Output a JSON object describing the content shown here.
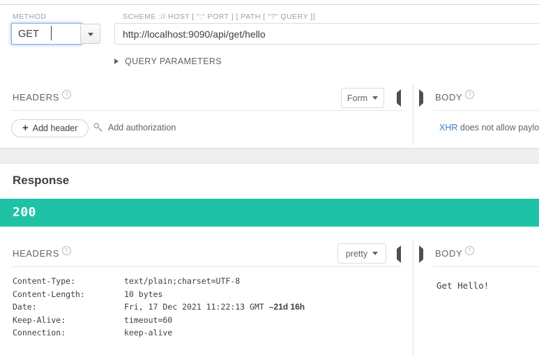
{
  "request": {
    "method_label": "METHOD",
    "method_value": "GET",
    "method_dropdown_icon": "chevron-down-icon",
    "url_label": "SCHEME :// HOST [ \":\" PORT ] [ PATH [ \"?\" QUERY ]]",
    "url_value": "http://localhost:9090/api/get/hello",
    "url_placeholder": "http://",
    "query_parameters_label": "QUERY PARAMETERS",
    "query_parameters_toggle_icon": "triangle-right-icon",
    "headers": {
      "title": "HEADERS",
      "help_icon": "question-circle-icon",
      "view_mode": "Form",
      "collapse_left_icon": "triangle-left-icon",
      "add_header_label": "Add header",
      "add_header_icon": "plus-icon",
      "add_authorization_label": "Add authorization",
      "add_authorization_icon": "key-icon"
    },
    "body": {
      "title": "BODY",
      "help_icon": "question-circle-icon",
      "expand_right_icon": "triangle-right-icon",
      "note_link": "XHR",
      "note_rest": " does not allow payloa"
    }
  },
  "response": {
    "title": "Response",
    "status_code": "200",
    "status_color": "#1ec2a4",
    "headers": {
      "title": "HEADERS",
      "help_icon": "question-circle-icon",
      "view_mode": "pretty",
      "collapse_left_icon": "triangle-left-icon",
      "rows": [
        {
          "key": "Content-Type:",
          "value": "text/plain;charset=UTF-8",
          "age": ""
        },
        {
          "key": "Content-Length:",
          "value": "10 bytes",
          "age": ""
        },
        {
          "key": "Date:",
          "value": "Fri, 17 Dec 2021 11:22:13 GMT ",
          "age": "–21d 16h"
        },
        {
          "key": "Keep-Alive:",
          "value": "timeout=60",
          "age": ""
        },
        {
          "key": "Connection:",
          "value": "keep-alive",
          "age": ""
        }
      ]
    },
    "body": {
      "title": "BODY",
      "help_icon": "question-circle-icon",
      "expand_right_icon": "triangle-right-icon",
      "content": "Get Hello!"
    }
  }
}
